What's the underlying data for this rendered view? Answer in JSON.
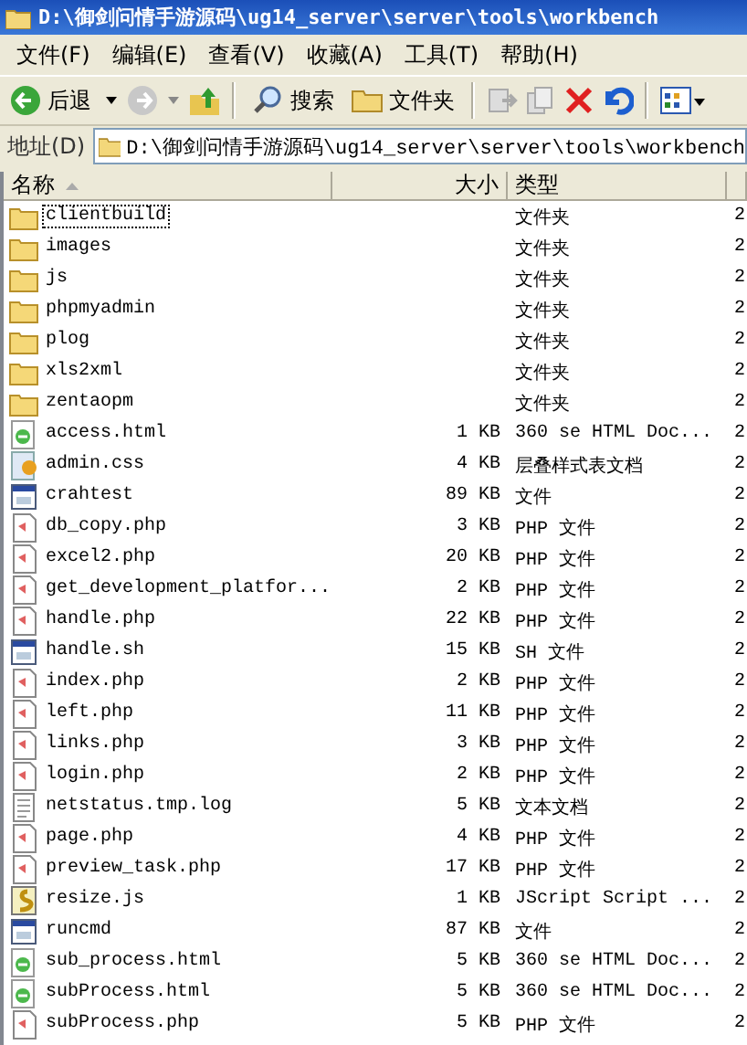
{
  "window": {
    "title": "D:\\御剑问情手游源码\\ug14_server\\server\\tools\\workbench"
  },
  "menu": [
    "文件(F)",
    "编辑(E)",
    "查看(V)",
    "收藏(A)",
    "工具(T)",
    "帮助(H)"
  ],
  "toolbar": {
    "back": "后退",
    "search": "搜索",
    "folders": "文件夹"
  },
  "address": {
    "label": "地址(D)",
    "value": "D:\\御剑问情手游源码\\ug14_server\\server\\tools\\workbench"
  },
  "columns": [
    "名称",
    "大小",
    "类型"
  ],
  "rows": [
    {
      "kind": "folder",
      "name": "clientbuild",
      "size": "",
      "type": "文件夹",
      "date": "2",
      "focused": true
    },
    {
      "kind": "folder",
      "name": "images",
      "size": "",
      "type": "文件夹",
      "date": "2",
      "focused": false
    },
    {
      "kind": "folder",
      "name": "js",
      "size": "",
      "type": "文件夹",
      "date": "2",
      "focused": false
    },
    {
      "kind": "folder",
      "name": "phpmyadmin",
      "size": "",
      "type": "文件夹",
      "date": "2",
      "focused": false
    },
    {
      "kind": "folder",
      "name": "plog",
      "size": "",
      "type": "文件夹",
      "date": "2",
      "focused": false
    },
    {
      "kind": "folder",
      "name": "xls2xml",
      "size": "",
      "type": "文件夹",
      "date": "2",
      "focused": false
    },
    {
      "kind": "folder",
      "name": "zentaopm",
      "size": "",
      "type": "文件夹",
      "date": "2",
      "focused": false
    },
    {
      "kind": "html",
      "name": "access.html",
      "size": "1 KB",
      "type": "360 se HTML Doc...",
      "date": "2",
      "focused": false
    },
    {
      "kind": "css",
      "name": "admin.css",
      "size": "4 KB",
      "type": "层叠样式表文档",
      "date": "2",
      "focused": false
    },
    {
      "kind": "app",
      "name": "crahtest",
      "size": "89 KB",
      "type": "文件",
      "date": "2",
      "focused": false
    },
    {
      "kind": "php",
      "name": "db_copy.php",
      "size": "3 KB",
      "type": "PHP 文件",
      "date": "2",
      "focused": false
    },
    {
      "kind": "php",
      "name": "excel2.php",
      "size": "20 KB",
      "type": "PHP 文件",
      "date": "2",
      "focused": false
    },
    {
      "kind": "php",
      "name": "get_development_platfor...",
      "size": "2 KB",
      "type": "PHP 文件",
      "date": "2",
      "focused": false
    },
    {
      "kind": "php",
      "name": "handle.php",
      "size": "22 KB",
      "type": "PHP 文件",
      "date": "2",
      "focused": false
    },
    {
      "kind": "app",
      "name": "handle.sh",
      "size": "15 KB",
      "type": "SH 文件",
      "date": "2",
      "focused": false
    },
    {
      "kind": "php",
      "name": "index.php",
      "size": "2 KB",
      "type": "PHP 文件",
      "date": "2",
      "focused": false
    },
    {
      "kind": "php",
      "name": "left.php",
      "size": "11 KB",
      "type": "PHP 文件",
      "date": "2",
      "focused": false
    },
    {
      "kind": "php",
      "name": "links.php",
      "size": "3 KB",
      "type": "PHP 文件",
      "date": "2",
      "focused": false
    },
    {
      "kind": "php",
      "name": "login.php",
      "size": "2 KB",
      "type": "PHP 文件",
      "date": "2",
      "focused": false
    },
    {
      "kind": "text",
      "name": "netstatus.tmp.log",
      "size": "5 KB",
      "type": "文本文档",
      "date": "2",
      "focused": false
    },
    {
      "kind": "php",
      "name": "page.php",
      "size": "4 KB",
      "type": "PHP 文件",
      "date": "2",
      "focused": false
    },
    {
      "kind": "php",
      "name": "preview_task.php",
      "size": "17 KB",
      "type": "PHP 文件",
      "date": "2",
      "focused": false
    },
    {
      "kind": "js",
      "name": "resize.js",
      "size": "1 KB",
      "type": "JScript Script ...",
      "date": "2",
      "focused": false
    },
    {
      "kind": "app",
      "name": "runcmd",
      "size": "87 KB",
      "type": "文件",
      "date": "2",
      "focused": false
    },
    {
      "kind": "html",
      "name": "sub_process.html",
      "size": "5 KB",
      "type": "360 se HTML Doc...",
      "date": "2",
      "focused": false
    },
    {
      "kind": "html",
      "name": "subProcess.html",
      "size": "5 KB",
      "type": "360 se HTML Doc...",
      "date": "2",
      "focused": false
    },
    {
      "kind": "php",
      "name": "subProcess.php",
      "size": "5 KB",
      "type": "PHP 文件",
      "date": "2",
      "focused": false
    }
  ]
}
